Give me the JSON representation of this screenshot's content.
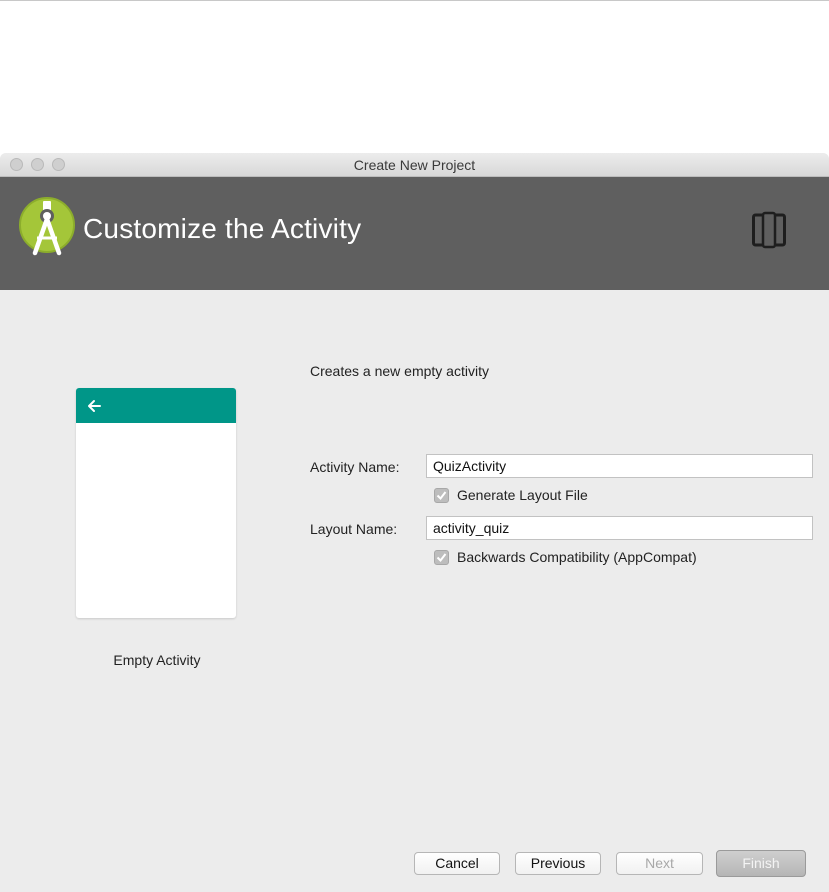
{
  "window": {
    "title": "Create New Project"
  },
  "banner": {
    "title": "Customize the Activity"
  },
  "preview": {
    "label": "Empty Activity"
  },
  "form": {
    "description": "Creates a new empty activity",
    "activity_name": {
      "label": "Activity Name:",
      "value": "QuizActivity"
    },
    "generate_layout": {
      "label": "Generate Layout File",
      "checked": true
    },
    "layout_name": {
      "label": "Layout Name:",
      "value": "activity_quiz"
    },
    "backwards_compat": {
      "label": "Backwards Compatibility (AppCompat)",
      "checked": true
    }
  },
  "buttons": {
    "cancel": "Cancel",
    "previous": "Previous",
    "next": "Next",
    "finish": "Finish"
  },
  "colors": {
    "banner": "#5f5f5f",
    "android_green": "#a4c639",
    "appbar_teal": "#009688"
  },
  "icons": [
    "android-studio-logo-icon",
    "device-form-factor-icon",
    "back-arrow-icon",
    "checkmark-icon"
  ]
}
